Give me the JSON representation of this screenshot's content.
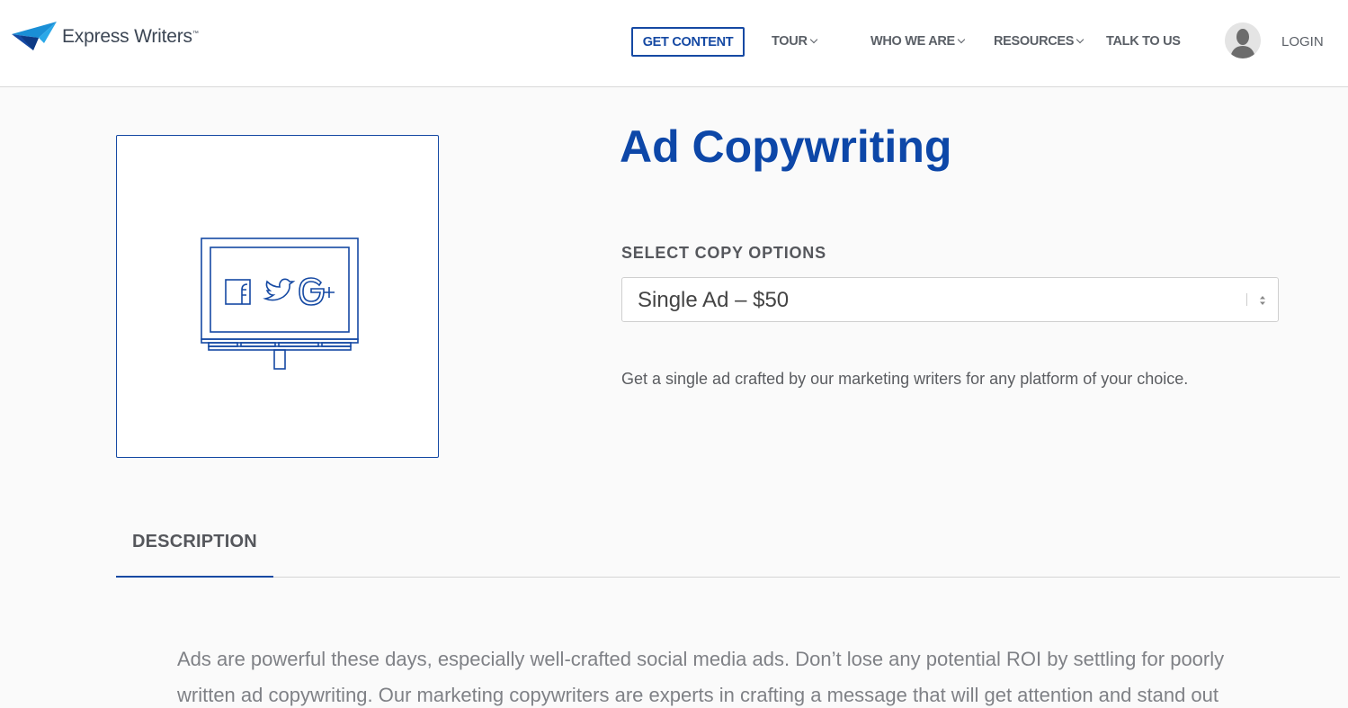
{
  "header": {
    "logo_text": "Express Writers",
    "logo_tm": "™",
    "nav": {
      "get_content": "GET CONTENT",
      "tour": "TOUR",
      "who_we_are": "WHO WE ARE",
      "resources": "RESOURCES",
      "talk_to_us": "TALK TO US",
      "login": "LOGIN"
    }
  },
  "product": {
    "title": "Ad Copywriting",
    "select_label": "SELECT COPY OPTIONS",
    "select_value": "Single Ad – $50",
    "description": "Get a single ad crafted by our marketing writers for any platform of your choice.",
    "image_icons": [
      "facebook-icon",
      "twitter-icon",
      "google-plus-icon"
    ]
  },
  "tabs": [
    {
      "label": "DESCRIPTION",
      "active": true
    }
  ],
  "body": {
    "lines": [
      "Ads are powerful these days, especially well-crafted social media ads. Don’t lose any potential ROI by settling for poorly",
      "written ad copywriting. Our marketing copywriters are experts in crafting a message that will get attention and stand out"
    ]
  },
  "colors": {
    "brand_blue": "#1549a3",
    "title_blue": "#0d47a8",
    "logo_light_blue": "#2aa8e8"
  }
}
